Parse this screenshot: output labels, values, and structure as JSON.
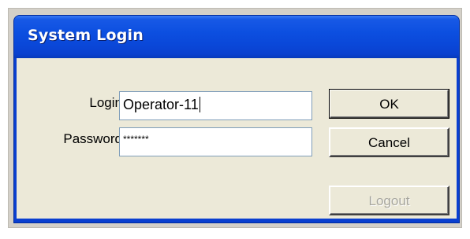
{
  "window": {
    "title": "System Login"
  },
  "form": {
    "login_label": "Login",
    "login_value": "Operator-11",
    "password_label": "Password",
    "password_value": "*******"
  },
  "buttons": {
    "ok_label": "OK",
    "cancel_label": "Cancel",
    "logout_label": "Logout",
    "logout_enabled": false
  },
  "colors": {
    "titlebar": "#0a47d8",
    "dialog_face": "#ece9d8",
    "disabled_text": "#a7a69e"
  }
}
